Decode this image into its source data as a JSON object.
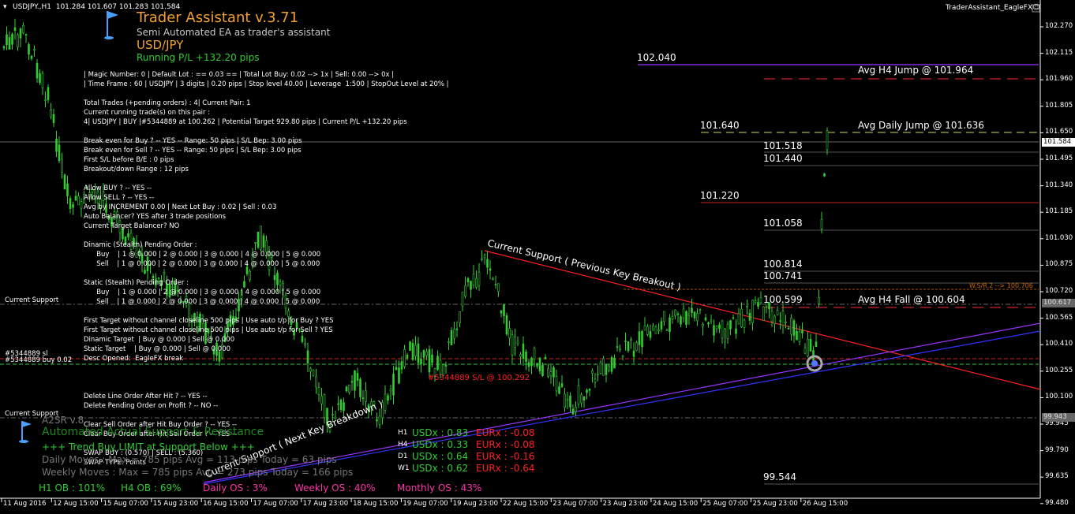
{
  "header": {
    "symbol_line": "USDJPY.,H1  101.284 101.607 101.283 101.584",
    "ea_name": "TraderAssistant_EagleFX☺"
  },
  "ea_panel": {
    "title": "Trader Assistant v.3.71",
    "subtitle": "Semi Automated EA as trader's assistant",
    "pair": "USD/JPY",
    "running_pl": "Running P/L +132.20 pips",
    "settings_line1": "| Magic Number: 0 | Default Lot : == 0.03 == | Total Lot Buy: 0.02 --> 1x | Sell: 0.00 --> 0x |",
    "settings_line2": "| Time Frame : 60 | USDJPY | 3 digits | 0.20 pips | Stop level 40.00 | Leverage  1:500 | StopOut Level at 20% |",
    "lines": [
      "Total Trades (+pending orders) : 4| Current Pair: 1",
      "Current running trade(s) on this pair :",
      "4| USDJPY | BUY |#5344889 at 100.262 | Potential Target 929.80 pips | Current P/L +132.20 pips",
      "",
      "Break even for Buy ? -- YES -- Range: 50 pips | S/L Bep: 3.00 pips",
      "Break even for Sell ? -- YES -- Range: 50 pips | S/L Bep: 3.00 pips",
      "First S/L before B/E : 0 pips",
      "Breakout/down Range : 12 pips",
      "",
      "Allow BUY ? -- YES --",
      "Allow SELL ? -- YES --",
      "Avg by INCREMENT 0.00 | Next Lot Buy : 0.02 | Sell : 0.03",
      "Auto Balancer? YES after 3 trade positions",
      "Current Target Balancer? NO",
      "",
      "Dinamic (Stealth) Pending Order :",
      "      Buy    | 1 @ 0.000 | 2 @ 0.000 | 3 @ 0.000 | 4 @ 0.000 | 5 @ 0.000",
      "      Sell    | 1 @ 0.000 | 2 @ 0.000 | 3 @ 0.000 | 4 @ 0.000 | 5 @ 0.000",
      "",
      "Static (Stealth) Pending Order :",
      "      Buy    | 1 @ 0.000 | 2 @ 0.000 | 3 @ 0.000 | 4 @ 0.000 | 5 @ 0.000",
      "      Sell    | 1 @ 0.000 | 2 @ 0.000 | 3 @ 0.000 | 4 @ 0.000 | 5 @ 0.000",
      "",
      "First Target without channel closeline 500 pips | Use auto t/p for Buy ? YES",
      "First Target without channel closeline 500 pips | Use auto t/p for Sell ? YES",
      "Dinamic Target  | Buy @ 0.000 | Sell @ 0.000",
      "Static Target    | Buy @ 0.000 | Sell @ 0.000",
      "Desc Opened:  EagleFX break",
      "",
      "",
      "",
      "Delete Line Order After Hit ? -- YES --",
      "Delete Pending Order on Profit ? -- NO --",
      "",
      "Clear Sell Order after Hit Buy Order ? -- YES --",
      "Clear Buy Order after Hit Sell Order ? -- YES --",
      "",
      "SWAP BUY : (0.570) | SELL : (5.360)",
      "SWAP TYPE: Points"
    ]
  },
  "a2sr": {
    "name": "A2SR v.8",
    "title": "Automated Actual Support & Resistance",
    "trend": "+++  Trend  Buy  LIMIT  at Support Below +++",
    "daily": "Daily Moves    : Max = 785 pips Avg = 113 pips Today = 63 pips",
    "weekly": "Weekly Moves : Max = 785 pips Avg = 273 pips Today = 166 pips",
    "ob": [
      {
        "label": "H1 OB : 101%",
        "color": "#33cc33"
      },
      {
        "label": "H4 OB : 69%",
        "color": "#33cc33"
      },
      {
        "label": "Daily OS : 3%",
        "color": "#ff33aa"
      },
      {
        "label": "Weekly OS : 40%",
        "color": "#ff33aa"
      },
      {
        "label": "Monthly OS : 43%",
        "color": "#ff33aa"
      }
    ],
    "strength": [
      {
        "tf": "H1",
        "usd": "USDx : 0.83",
        "eur": "EURx : -0.08"
      },
      {
        "tf": "H4",
        "usd": "USDx : 0.33",
        "eur": "EURx : -0.08"
      },
      {
        "tf": "D1",
        "usd": "USDx : 0.64",
        "eur": "EURx : -0.16"
      },
      {
        "tf": "W1",
        "usd": "USDx : 0.62",
        "eur": "EURx : -0.64"
      }
    ]
  },
  "levels": {
    "l102040": "102.040",
    "avg_h4_jump": "Avg H4 Jump @ 101.964",
    "l101640": "101.640",
    "avg_daily_jump": "Avg Daily Jump @ 101.636",
    "l101518": "101.518",
    "l101440": "101.440",
    "l101220": "101.220",
    "l101058": "101.058",
    "l100814": "100.814",
    "l100741": "100.741",
    "l100599": "100.599",
    "avg_h4_fall": "Avg H4 Fall @ 100.604",
    "l99544": "99.544",
    "wsr2": "W.S/R.2 --> 100.706",
    "current_support_1": "Current Support",
    "current_support_2": "Current Support",
    "order_sl": "#5344889 sl",
    "order_buy": "#5344889 buy 0.02",
    "sl_label": "#5344889 S/L @ 100.292",
    "support_label_top": "Current Support ( Previous Key Breakout )",
    "support_label_bottom": "Current Support ( Next Key Breakdown )"
  },
  "price_axis": {
    "ticks": [
      "102.270",
      "102.115",
      "101.960",
      "101.805",
      "101.650",
      "101.495",
      "101.340",
      "101.185",
      "101.030",
      "100.875",
      "100.720",
      "100.565",
      "100.410",
      "100.255",
      "100.100",
      "99.945",
      "99.790",
      "99.635",
      "99.480"
    ],
    "current_price": "101.584",
    "tag_100617": "100.617",
    "tag_99943": "99.943"
  },
  "time_axis": {
    "ticks": [
      "11 Aug 2016",
      "12 Aug 15:00",
      "15 Aug 07:00",
      "15 Aug 23:00",
      "16 Aug 15:00",
      "17 Aug 07:00",
      "17 Aug 23:00",
      "18 Aug 15:00",
      "19 Aug 07:00",
      "19 Aug 23:00",
      "22 Aug 15:00",
      "23 Aug 07:00",
      "23 Aug 23:00",
      "24 Aug 15:00",
      "25 Aug 07:00",
      "25 Aug 23:00",
      "26 Aug 15:00"
    ]
  },
  "colors": {
    "candle": "#33cc33",
    "support_red": "#ff2020",
    "purple": "#9933ff",
    "blue": "#3333ff",
    "orange": "#f0a030"
  }
}
